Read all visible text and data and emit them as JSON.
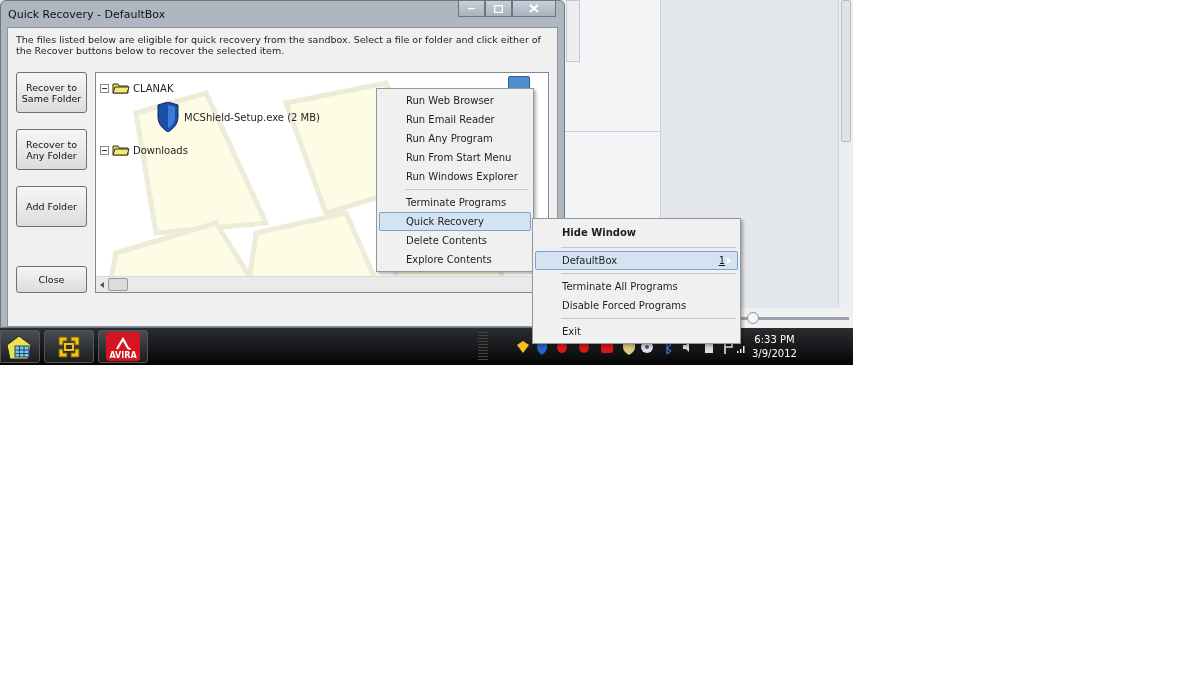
{
  "window": {
    "title": "Quick Recovery - DefaultBox",
    "description": "The files listed below are eligible for quick recovery from the sandbox.  Select a file or folder and click either of the Recover buttons below to recover the selected item.",
    "buttons": [
      {
        "label": "Recover to Same Folder"
      },
      {
        "label": "Recover to Any Folder"
      },
      {
        "label": "Add Folder"
      },
      {
        "label": "Close"
      }
    ],
    "tree": [
      {
        "label": "CLANAK",
        "kind": "folder",
        "expanded": true,
        "children": [
          {
            "label": "MCShield-Setup.exe  (2 MB)",
            "kind": "file"
          }
        ]
      },
      {
        "label": "Downloads",
        "kind": "folder",
        "expanded": true
      }
    ]
  },
  "context_menu": {
    "groups": [
      [
        {
          "label": "Run Web Browser",
          "selected": false
        },
        {
          "label": "Run Email Reader",
          "selected": false
        },
        {
          "label": "Run Any Program",
          "selected": false
        },
        {
          "label": "Run From Start Menu",
          "selected": false
        },
        {
          "label": "Run Windows Explorer",
          "selected": false
        }
      ],
      [
        {
          "label": "Terminate Programs",
          "selected": false
        },
        {
          "label": "Quick Recovery",
          "selected": true
        },
        {
          "label": "Delete Contents",
          "selected": false
        },
        {
          "label": "Explore Contents",
          "selected": false
        }
      ]
    ]
  },
  "tray_menu": {
    "groups": [
      [
        {
          "label": "Hide Window",
          "kind": "default",
          "selected": false
        }
      ],
      [
        {
          "label": "DefaultBox",
          "kind": "submenu",
          "shortcut": "1",
          "selected": true
        }
      ],
      [
        {
          "label": "Terminate All Programs",
          "kind": "item",
          "selected": false
        },
        {
          "label": "Disable Forced Programs",
          "kind": "item",
          "selected": false
        }
      ],
      [
        {
          "label": "Exit",
          "kind": "item",
          "selected": false
        }
      ]
    ]
  },
  "background_window": {
    "slider": {
      "level": 0.12
    }
  },
  "taskbar": {
    "apps": [
      {
        "kind": "start"
      },
      {
        "kind": "vm"
      },
      {
        "kind": "avira",
        "label": "AVIRA"
      }
    ],
    "time": "6:33 PM",
    "date": "3/9/2012"
  }
}
